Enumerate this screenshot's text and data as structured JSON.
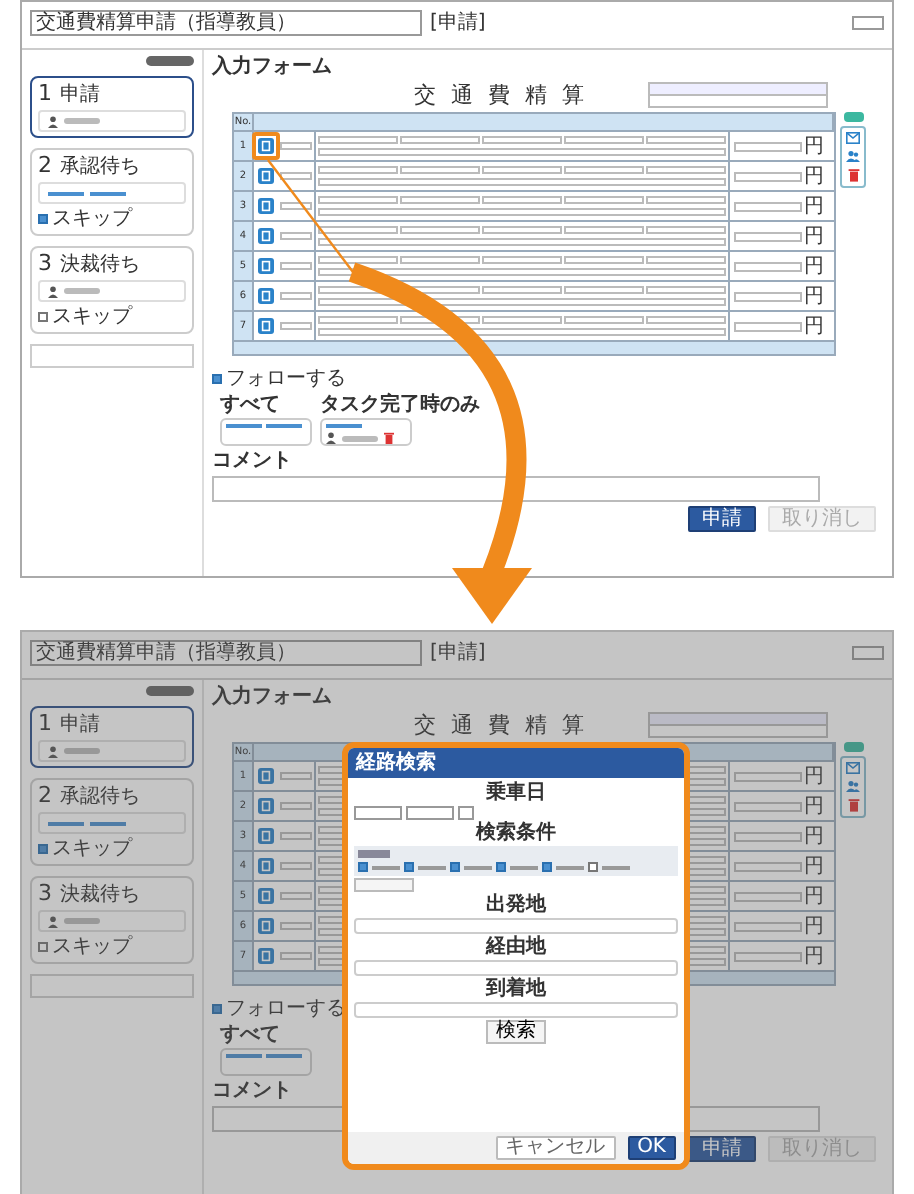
{
  "screens": [
    {
      "kind": "form",
      "title": "交通費精算申請（指導教員）",
      "status": "[申請]",
      "form_heading": "入力フォーム",
      "sheet_title": "交 通 費 精 算",
      "steps": [
        {
          "number": "1",
          "label": "申請",
          "kind": "user",
          "selected": true
        },
        {
          "number": "2",
          "label": "承認待ち",
          "kind": "links",
          "selected": false,
          "skip_label": "スキップ",
          "skip_checked": true
        },
        {
          "number": "3",
          "label": "決裁待ち",
          "kind": "user",
          "selected": false,
          "skip_label": "スキップ",
          "skip_checked": false
        }
      ],
      "no_header": "No.",
      "rows": [
        {
          "number": "1",
          "unit": "円",
          "highlighted": true
        },
        {
          "number": "2",
          "unit": "円",
          "highlighted": false
        },
        {
          "number": "3",
          "unit": "円",
          "highlighted": false
        },
        {
          "number": "4",
          "unit": "円",
          "highlighted": false
        },
        {
          "number": "5",
          "unit": "円",
          "highlighted": false
        },
        {
          "number": "6",
          "unit": "円",
          "highlighted": false
        },
        {
          "number": "7",
          "unit": "円",
          "highlighted": false
        }
      ],
      "follow": {
        "label": "フォローする",
        "checked": true
      },
      "all_label": "すべて",
      "task_label": "タスク完了時のみ",
      "comment_label": "コメント",
      "apply_button": "申請",
      "withdraw_button": "取り消し"
    },
    {
      "kind": "dialog",
      "title": "交通費精算申請（指導教員）",
      "status": "[申請]",
      "form_heading": "入力フォーム",
      "sheet_title": "交 通 費 精 算",
      "steps": [
        {
          "number": "1",
          "label": "申請",
          "kind": "user",
          "selected": true
        },
        {
          "number": "2",
          "label": "承認待ち",
          "kind": "links",
          "selected": false,
          "skip_label": "スキップ",
          "skip_checked": true
        },
        {
          "number": "3",
          "label": "決裁待ち",
          "kind": "user",
          "selected": false,
          "skip_label": "スキップ",
          "skip_checked": false
        }
      ],
      "no_header": "No.",
      "rows": [
        {
          "number": "1",
          "unit": "円",
          "highlighted": false
        },
        {
          "number": "2",
          "unit": "円",
          "highlighted": false
        },
        {
          "number": "3",
          "unit": "円",
          "highlighted": false
        },
        {
          "number": "4",
          "unit": "円",
          "highlighted": false
        },
        {
          "number": "5",
          "unit": "円",
          "highlighted": false
        },
        {
          "number": "6",
          "unit": "円",
          "highlighted": false
        },
        {
          "number": "7",
          "unit": "円",
          "highlighted": false
        }
      ],
      "follow": {
        "label": "フォローする",
        "checked": true
      },
      "all_label": "すべて",
      "comment_label": "コメント",
      "apply_button": "申請",
      "withdraw_button": "取り消し",
      "dialog": {
        "title": "経路検索",
        "date_heading": "乗車日",
        "condition_heading": "検索条件",
        "options": [
          {
            "checked": true
          },
          {
            "checked": true
          },
          {
            "checked": true
          },
          {
            "checked": true
          },
          {
            "checked": true
          },
          {
            "checked": false
          }
        ],
        "places": [
          "出発地",
          "経由地",
          "到着地"
        ],
        "search_button": "検索",
        "cancel_button": "キャンセル",
        "ok_button": "OK"
      }
    }
  ]
}
